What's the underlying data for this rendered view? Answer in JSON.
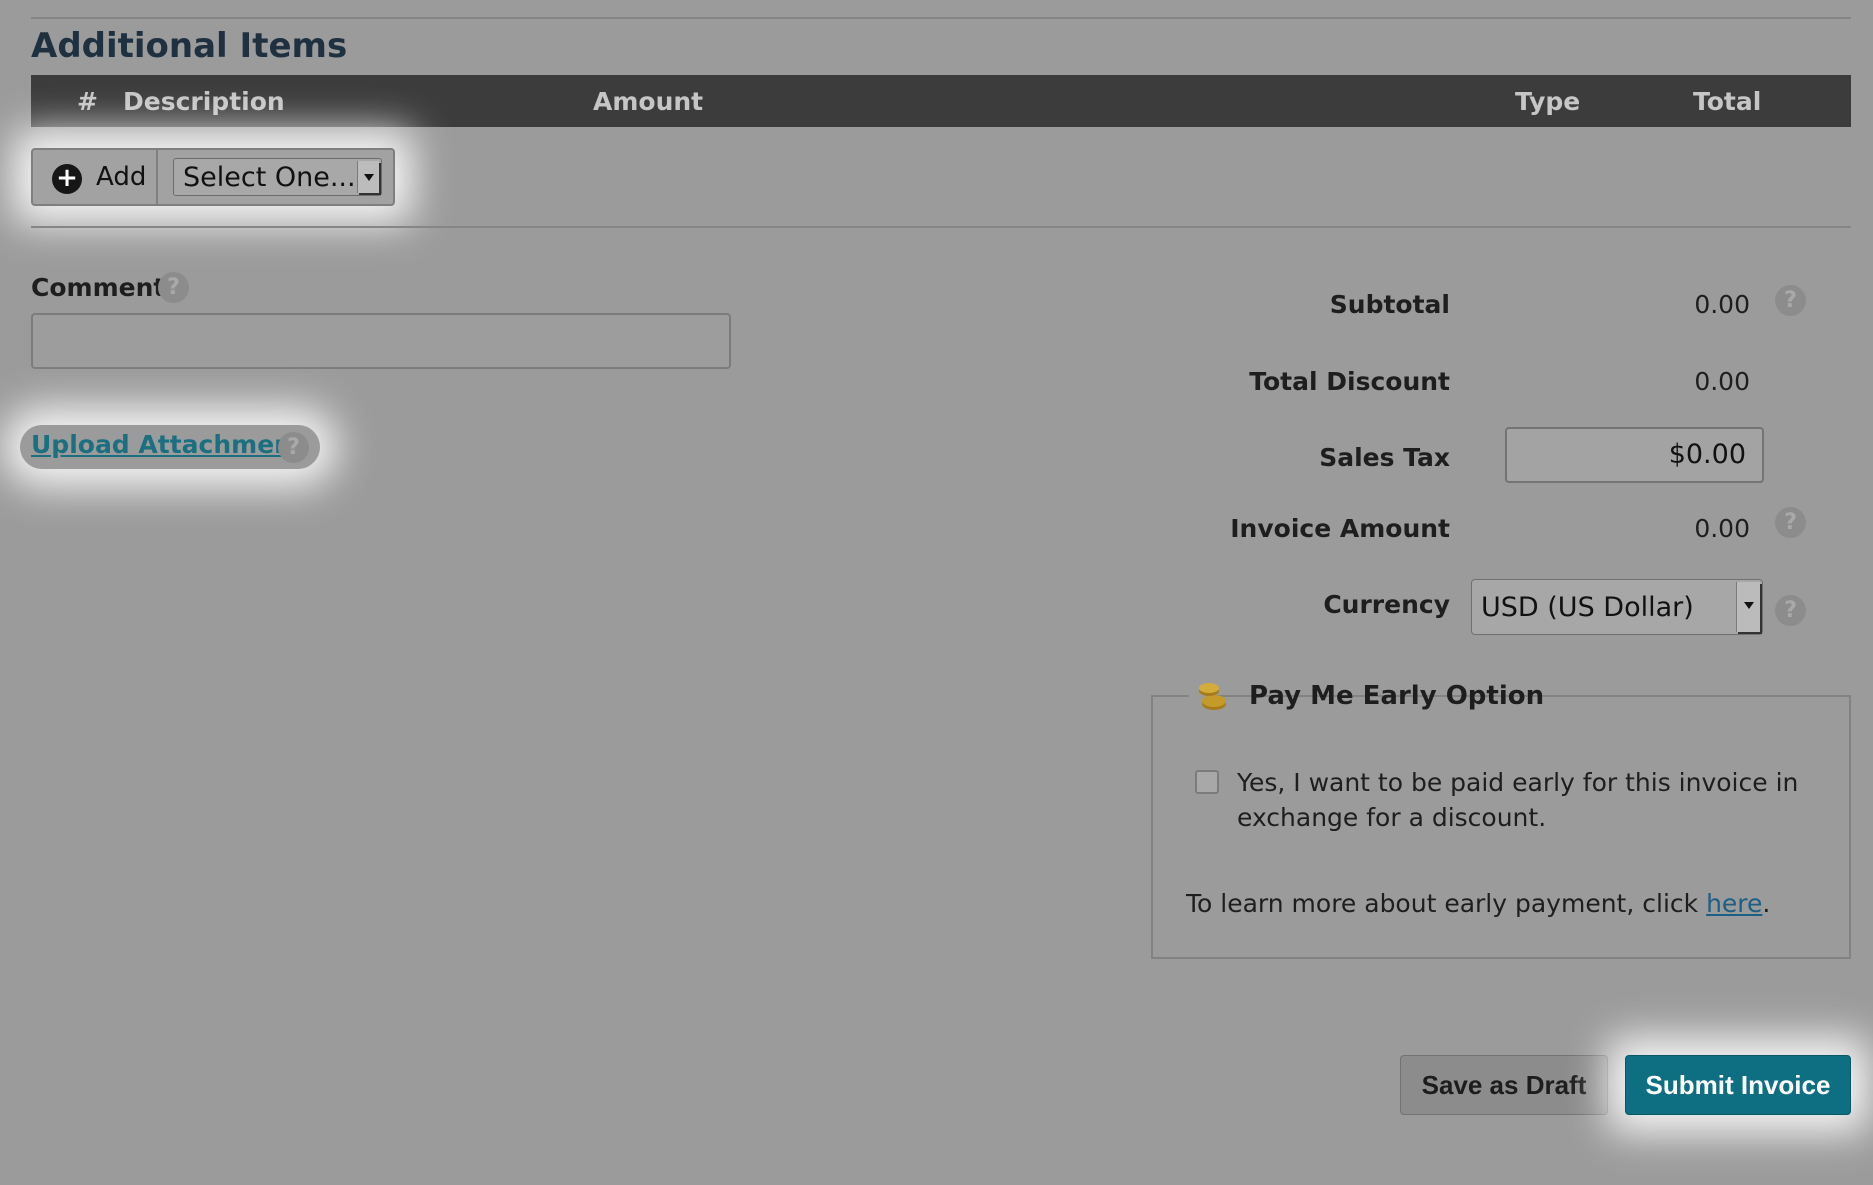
{
  "section": {
    "title": "Additional Items"
  },
  "items_table": {
    "columns": {
      "number": "#",
      "description": "Description",
      "amount": "Amount",
      "type": "Type",
      "total": "Total"
    }
  },
  "add_controls": {
    "add_label": "Add",
    "select_value": "Select One..."
  },
  "comment": {
    "label": "Comment",
    "value": ""
  },
  "help_glyph": "?",
  "upload": {
    "label": "Upload Attachment"
  },
  "summary": {
    "subtotal": {
      "label": "Subtotal",
      "value": "0.00"
    },
    "total_discount": {
      "label": "Total Discount",
      "value": "0.00"
    },
    "sales_tax": {
      "label": "Sales Tax",
      "value": "$0.00"
    },
    "invoice_amount": {
      "label": "Invoice Amount",
      "value": "0.00"
    },
    "currency": {
      "label": "Currency",
      "value": "USD (US Dollar)"
    }
  },
  "pay_early": {
    "title": "Pay Me Early Option",
    "icon": "coins-icon",
    "checkbox_checked": false,
    "checkbox_line1": "Yes, I want to be paid early for this invoice in",
    "checkbox_line2": "exchange for a discount.",
    "learn_prefix": "To learn more about early payment, click ",
    "learn_link": "here",
    "learn_suffix": "."
  },
  "actions": {
    "save_draft": "Save as Draft",
    "submit": "Submit Invoice"
  },
  "colors": {
    "background": "#9b9b9b",
    "header_bar": "#3c3c3c",
    "title": "#1f3040",
    "link": "#1a6f80",
    "submit": "#0f6f82",
    "coin": "#c49a2a"
  }
}
